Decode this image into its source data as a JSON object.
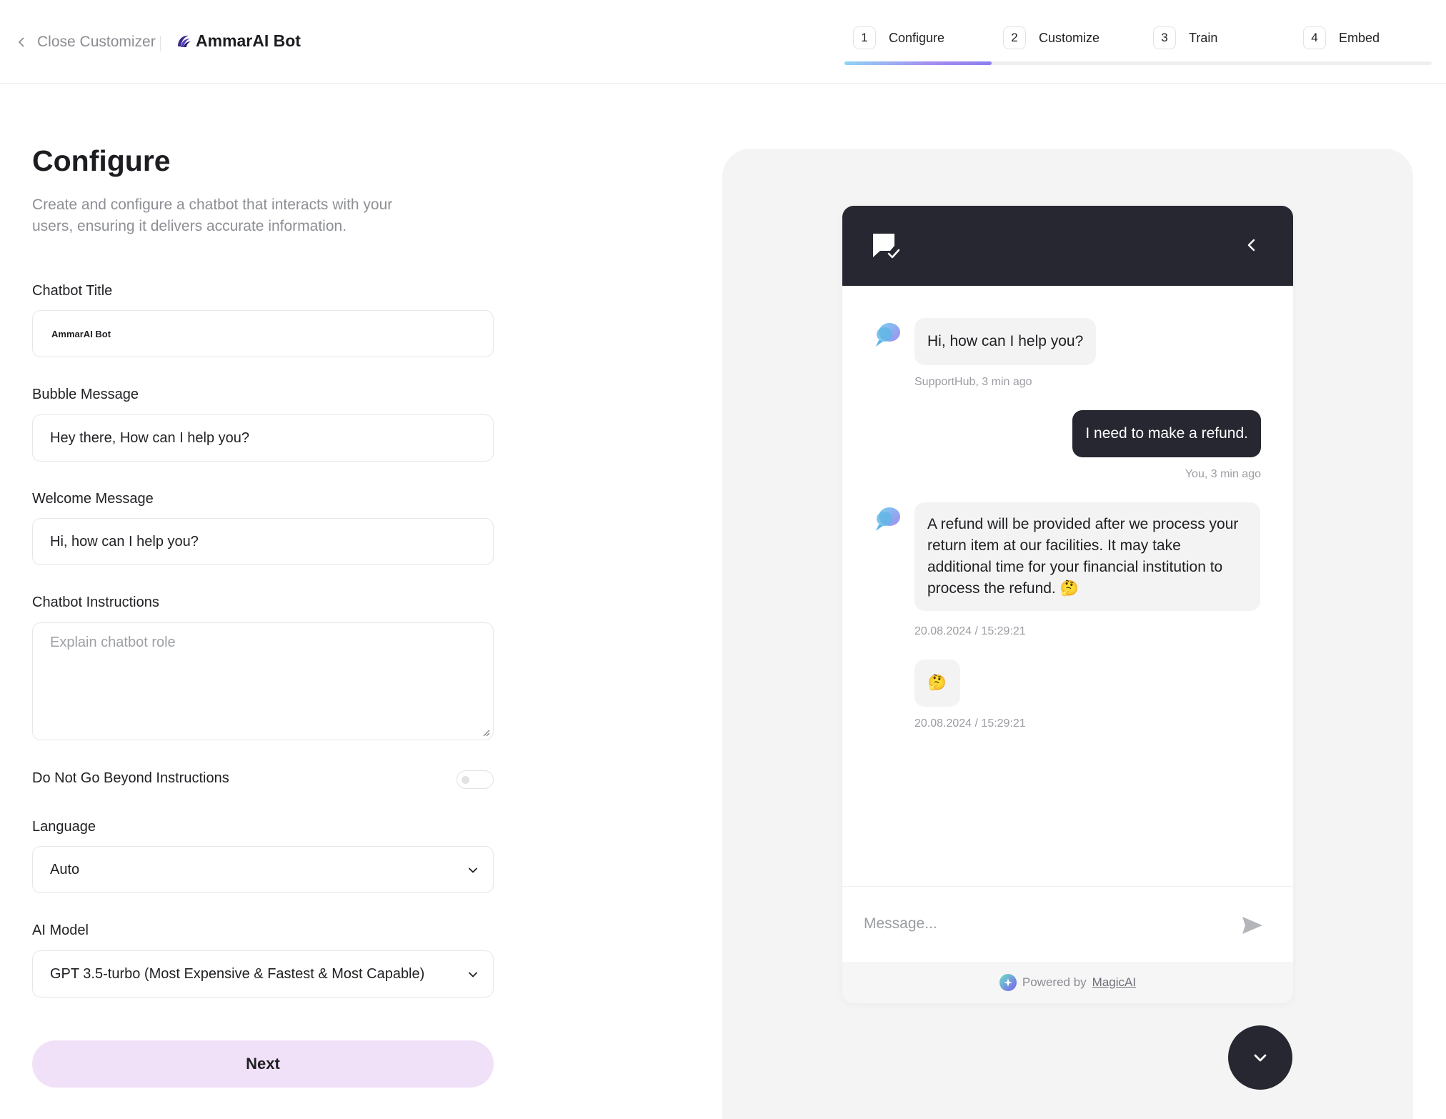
{
  "header": {
    "close_label": "Close Customizer",
    "brand_name": "AmmarAI Bot",
    "steps": [
      {
        "num": "1",
        "label": "Configure"
      },
      {
        "num": "2",
        "label": "Customize"
      },
      {
        "num": "3",
        "label": "Train"
      },
      {
        "num": "4",
        "label": "Embed"
      }
    ],
    "current_step": 1,
    "progress_fraction": 0.25
  },
  "form": {
    "title": "Configure",
    "description": "Create and configure a chatbot that interacts with your users, ensuring it delivers accurate information.",
    "chatbot_title_label": "Chatbot Title",
    "chatbot_title_value": "AmmarAI Bot",
    "bubble_label": "Bubble Message",
    "bubble_value": "Hey there, How can I help you?",
    "welcome_label": "Welcome Message",
    "welcome_value": "Hi, how can I help you?",
    "instructions_label": "Chatbot Instructions",
    "instructions_placeholder": "Explain chatbot role",
    "toggle_label": "Do Not Go Beyond Instructions",
    "toggle_on": false,
    "language_label": "Language",
    "language_value": "Auto",
    "model_label": "AI Model",
    "model_value": "GPT 3.5-turbo (Most Expensive & Fastest & Most Capable)",
    "next_label": "Next"
  },
  "preview": {
    "messages": [
      {
        "from": "bot",
        "text": "Hi, how can I help you?",
        "meta": "SupportHub, 3 min ago"
      },
      {
        "from": "user",
        "text": "I need to make a refund.",
        "meta": "You, 3 min ago"
      },
      {
        "from": "bot",
        "text": "A refund will be provided after we process your return item at our facilities. It may take additional time for your financial institution to process the refund. 🤔",
        "meta": "20.08.2024 / 15:29:21"
      },
      {
        "from": "bot",
        "text": "🤔",
        "meta": "20.08.2024 / 15:29:21"
      }
    ],
    "composer_placeholder": "Message...",
    "powered_by": "Powered by",
    "powered_link": "MagicAI"
  },
  "colors": {
    "accent_dark": "#262730",
    "next_button": "#f1e1f8",
    "progress_start": "#8fd3f4",
    "progress_end": "#8b7ff0"
  }
}
